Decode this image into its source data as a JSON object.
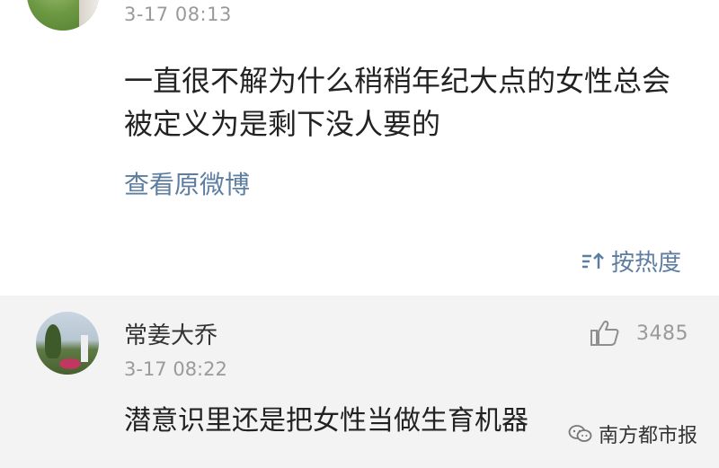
{
  "post": {
    "timestamp": "3-17 08:13",
    "content": "一直很不解为什么稍稍年纪大点的女性总会被定义为是剩下没人要的",
    "view_original_label": "查看原微博",
    "sort_label": "按热度",
    "sort_icon": "sort-icon"
  },
  "comment": {
    "username": "常姜大乔",
    "timestamp": "3-17 08:22",
    "text": "潜意识里还是把女性当做生育机器",
    "likes": "3485",
    "like_icon": "thumbs-up-icon"
  },
  "watermark": {
    "text": "南方都市报",
    "icon": "wechat-icon"
  },
  "colors": {
    "link": "#5d7ea0",
    "meta": "#9a9a9a",
    "comment_bg": "#f3f3f3"
  }
}
